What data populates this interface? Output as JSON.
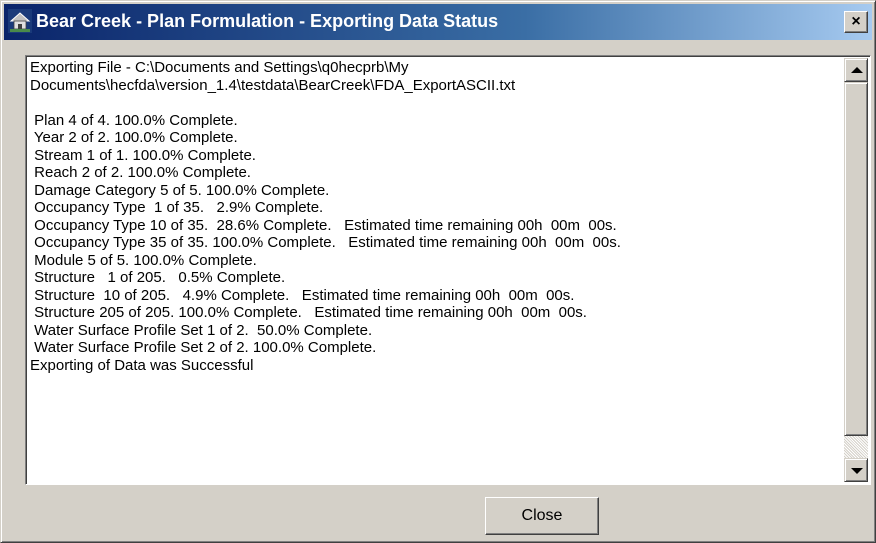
{
  "window": {
    "title": "Bear Creek - Plan Formulation - Exporting Data Status",
    "close_glyph": "×",
    "app_icon": "house-icon"
  },
  "output_log": {
    "lines": [
      "Exporting File - C:\\Documents and Settings\\q0hecprb\\My",
      "Documents\\hecfda\\version_1.4\\testdata\\BearCreek\\FDA_ExportASCII.txt",
      "",
      " Plan 4 of 4. 100.0% Complete.",
      " Year 2 of 2. 100.0% Complete.",
      " Stream 1 of 1. 100.0% Complete.",
      " Reach 2 of 2. 100.0% Complete.",
      " Damage Category 5 of 5. 100.0% Complete.",
      " Occupancy Type  1 of 35.   2.9% Complete.",
      " Occupancy Type 10 of 35.  28.6% Complete.   Estimated time remaining 00h  00m  00s.",
      " Occupancy Type 35 of 35. 100.0% Complete.   Estimated time remaining 00h  00m  00s.",
      " Module 5 of 5. 100.0% Complete.",
      " Structure   1 of 205.   0.5% Complete.",
      " Structure  10 of 205.   4.9% Complete.   Estimated time remaining 00h  00m  00s.",
      " Structure 205 of 205. 100.0% Complete.   Estimated time remaining 00h  00m  00s.",
      " Water Surface Profile Set 1 of 2.  50.0% Complete.",
      " Water Surface Profile Set 2 of 2. 100.0% Complete.",
      "Exporting of Data was Successful"
    ]
  },
  "buttons": {
    "close_label": "Close"
  },
  "colors": {
    "titlebar_start": "#0a246a",
    "titlebar_end": "#a6caf0",
    "face": "#d4d0c8"
  }
}
